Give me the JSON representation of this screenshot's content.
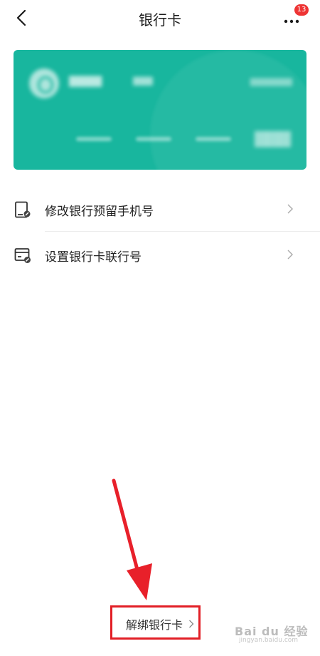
{
  "nav": {
    "title": "银行卡",
    "badge_count": "13"
  },
  "menu": {
    "items": [
      {
        "label": "修改银行预留手机号",
        "icon": "phone-card-edit-icon"
      },
      {
        "label": "设置银行卡联行号",
        "icon": "card-settings-icon"
      }
    ]
  },
  "footer": {
    "unbind_label": "解绑银行卡"
  },
  "watermark": {
    "text": "Bai du 经验",
    "url": "jingyan.baidu.com"
  },
  "colors": {
    "card": "#18b69e",
    "badge": "#ee3434",
    "highlight": "#e21f26"
  }
}
